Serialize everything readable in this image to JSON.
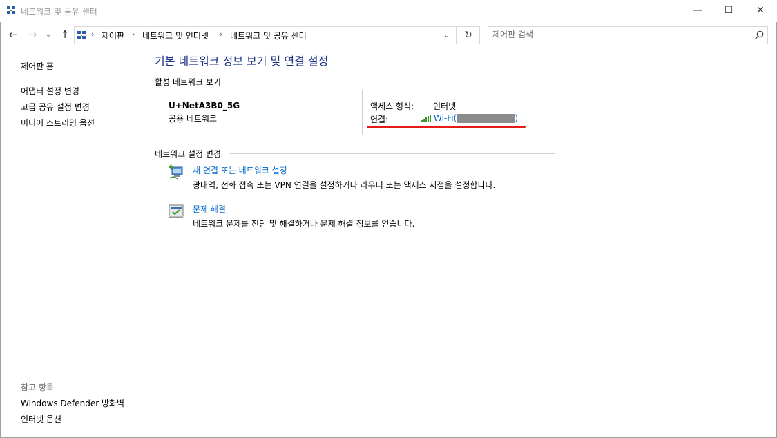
{
  "window": {
    "title": "네트워크 및 공유 센터",
    "icon": "network-sharing-icon",
    "controls": {
      "minimize": "—",
      "maximize": "☐",
      "close": "✕"
    }
  },
  "nav": {
    "back": "←",
    "forward": "→",
    "recent": "⌄",
    "up": "↑",
    "breadcrumb": [
      "제어판",
      "네트워크 및 인터넷",
      "네트워크 및 공유 센터"
    ],
    "separator": "›",
    "dropdown": "⌄",
    "refresh": "↻"
  },
  "search": {
    "placeholder": "제어판 검색",
    "value": ""
  },
  "sidebar": {
    "home": "제어판 홈",
    "links": [
      "어댑터 설정 변경",
      "고급 공유 설정 변경",
      "미디어 스트리밍 옵션"
    ],
    "see_also_heading": "참고 항목",
    "see_also": [
      "Windows Defender 방화벽",
      "인터넷 옵션"
    ]
  },
  "main": {
    "title": "기본 네트워크 정보 보기 및 연결 설정",
    "active_section": "활성 네트워크 보기",
    "network": {
      "name": "U+NetA3B0_5G",
      "type": "공용 네트워크",
      "access_label": "액세스 형식:",
      "access_value": "인터넷",
      "connection_label": "연결:",
      "connection_prefix": "Wi-Fi(",
      "connection_suffix": ")"
    },
    "settings_section": "네트워크 설정 변경",
    "tasks": [
      {
        "icon": "new-connection-icon",
        "link": "새 연결 또는 네트워크 설정",
        "desc": "광대역, 전화 접속 또는 VPN 연결을 설정하거나 라우터 또는 액세스 지점을 설정합니다."
      },
      {
        "icon": "troubleshoot-icon",
        "link": "문제 해결",
        "desc": "네트워크 문제를 진단 및 해결하거나 문제 해결 정보를 얻습니다."
      }
    ]
  },
  "colors": {
    "title_blue": "#1e3287",
    "link_blue": "#0066cc",
    "annotation_red": "#e41b17",
    "signal_green": "#3c9a2a"
  }
}
